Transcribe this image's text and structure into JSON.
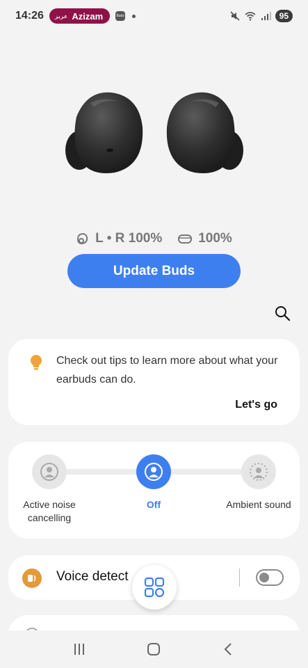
{
  "status_bar": {
    "time": "14:26",
    "profile_name": "Azizam",
    "profile_prefix": "عزیز",
    "notification_icon_label": "Buds",
    "battery_level": "95"
  },
  "battery": {
    "buds_label": "L • R 100%",
    "case_label": "100%"
  },
  "update_button": {
    "label": "Update Buds"
  },
  "tips": {
    "text": "Check out tips to learn more about what your earbuds can do.",
    "link_label": "Let's go"
  },
  "noise_control": {
    "options": [
      {
        "label": "Active noise cancelling",
        "active": false
      },
      {
        "label": "Off",
        "active": true
      },
      {
        "label": "Ambient sound",
        "active": false
      }
    ]
  },
  "voice_detect": {
    "label": "Voice detect",
    "enabled": false
  },
  "colors": {
    "accent": "#3e7ff0",
    "profile": "#8e1247",
    "tip_bulb": "#f2a33a",
    "voice_icon": "#e39a3a"
  },
  "icons": [
    "mute-icon",
    "wifi-icon",
    "signal-icon",
    "search-icon",
    "lightbulb-icon",
    "person-icon",
    "apps-grid-icon",
    "recent-apps-icon",
    "home-icon",
    "back-icon"
  ]
}
